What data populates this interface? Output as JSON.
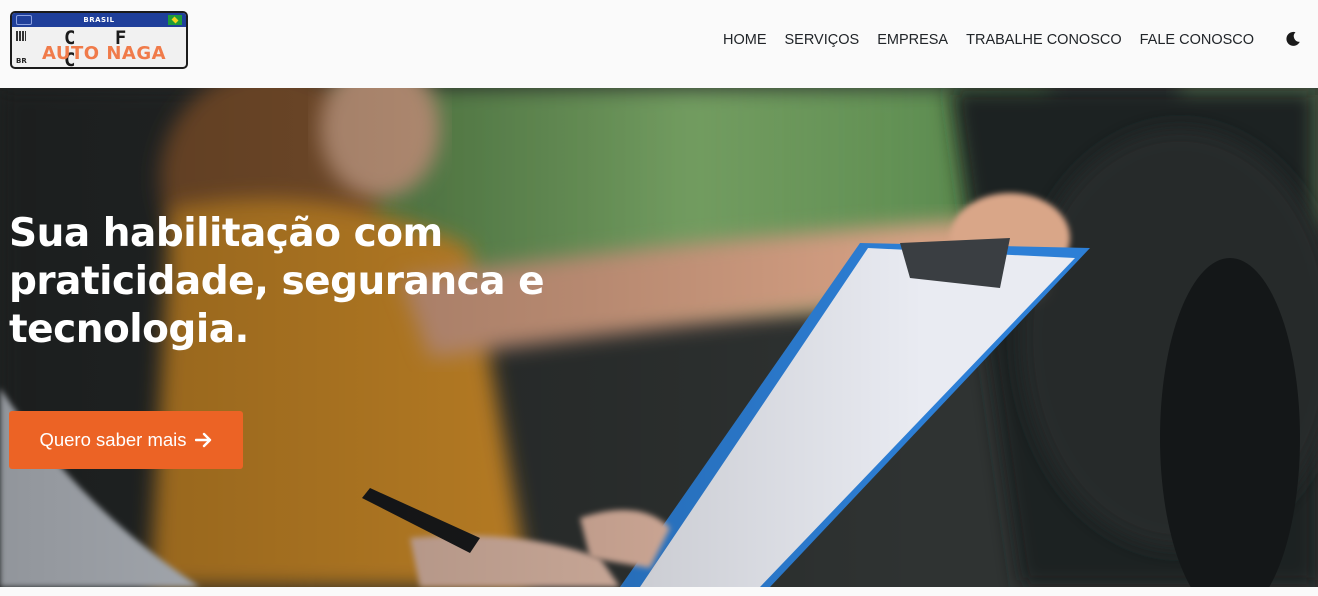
{
  "logo": {
    "country": "BRASIL",
    "code": "BR",
    "line1": "C F C",
    "line2": "AUTO NAGA"
  },
  "nav": {
    "items": [
      "HOME",
      "SERVIÇOS",
      "EMPRESA",
      "TRABALHE CONOSCO",
      "FALE CONOSCO"
    ],
    "theme_icon": "moon-icon"
  },
  "hero": {
    "title": "Sua habilitação com praticidade, seguranca e tecnologia.",
    "cta_label": "Quero saber mais",
    "cta_icon": "arrow-right-icon"
  },
  "colors": {
    "accent": "#ec6325",
    "plate_blue": "#1f3f9a",
    "text_dark": "#212529"
  }
}
